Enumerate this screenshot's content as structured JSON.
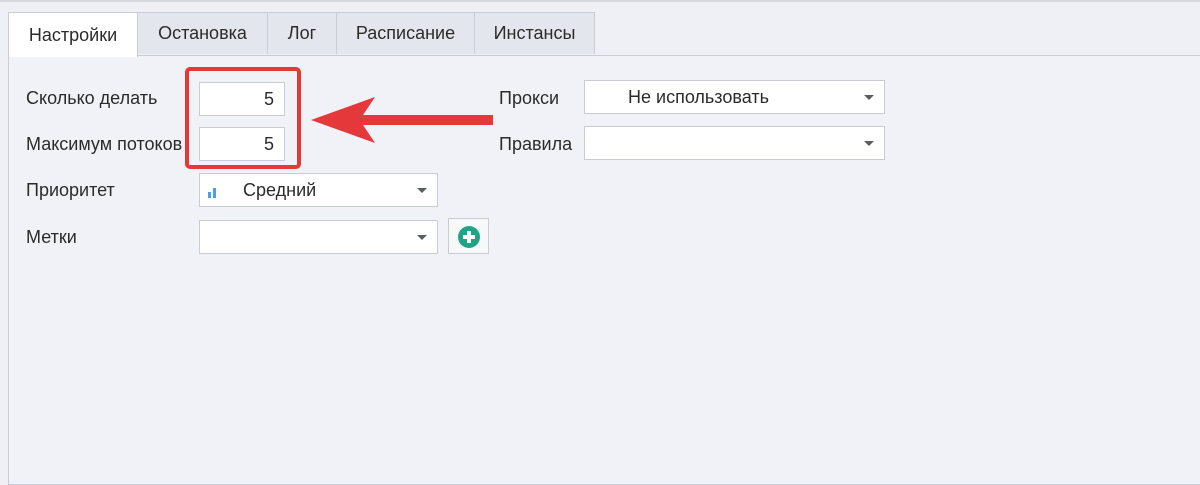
{
  "tabs": [
    {
      "label": "Настройки",
      "active": true
    },
    {
      "label": "Остановка",
      "active": false
    },
    {
      "label": "Лог",
      "active": false
    },
    {
      "label": "Расписание",
      "active": false
    },
    {
      "label": "Инстансы",
      "active": false
    }
  ],
  "form": {
    "count_label": "Сколько делать",
    "count_value": "5",
    "threads_label": "Максимум потоков",
    "threads_value": "5",
    "priority_label": "Приоритет",
    "priority_value": "Средний",
    "tags_label": "Метки",
    "tags_value": "",
    "proxy_label": "Прокси",
    "proxy_value": "Не использовать",
    "rules_label": "Правила",
    "rules_value": ""
  },
  "icons": {
    "priority": "signal-bars-icon",
    "add": "plus-circle-icon"
  },
  "colors": {
    "highlight": "#e5383b",
    "add_icon": "#20a486",
    "priority_icon": "#4b9ee8"
  }
}
